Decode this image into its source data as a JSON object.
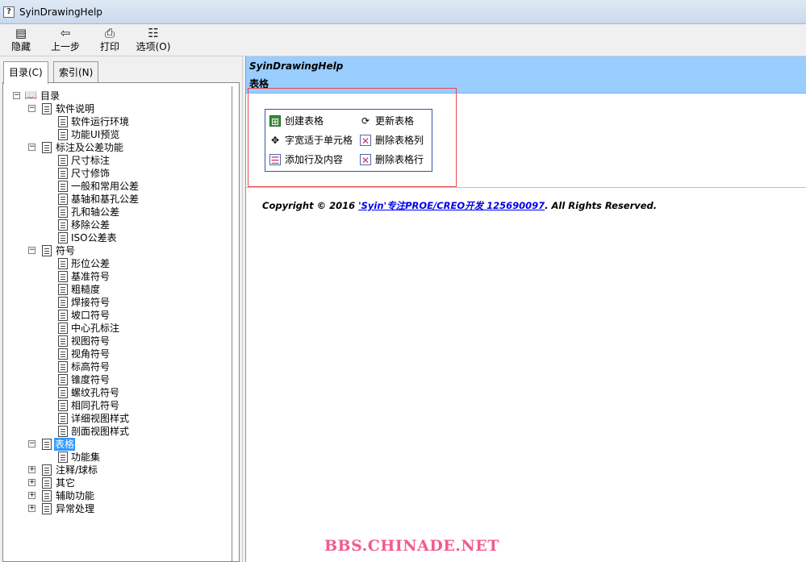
{
  "window": {
    "title": "SyinDrawingHelp",
    "icon": "help-question-icon"
  },
  "toolbar": {
    "buttons": [
      {
        "label": "隐藏",
        "icon": "hide-panel-icon"
      },
      {
        "label": "上一步",
        "icon": "back-arrow-icon"
      },
      {
        "label": "打印",
        "icon": "printer-icon"
      },
      {
        "label": "选项(O)",
        "icon": "options-icon"
      }
    ]
  },
  "nav_tabs": [
    {
      "label": "目录(C)",
      "active": true
    },
    {
      "label": "索引(N)",
      "active": false
    }
  ],
  "tree": {
    "root": "目录",
    "nodes": [
      "软件说明",
      "软件运行环境",
      "功能UI预览",
      "标注及公差功能",
      "尺寸标注",
      "尺寸修饰",
      "一般和常用公差",
      "基轴和基孔公差",
      "孔和轴公差",
      "移除公差",
      "ISO公差表",
      "符号",
      "形位公差",
      "基准符号",
      "粗糙度",
      "焊接符号",
      "坡口符号",
      "中心孔标注",
      "视图符号",
      "视角符号",
      "标高符号",
      "锥度符号",
      "螺纹孔符号",
      "相同孔符号",
      "详细视图样式",
      "剖面视图样式",
      "表格",
      "功能集",
      "注释/球标",
      "其它",
      "辅助功能",
      "异常处理"
    ],
    "toggles": {
      "minus": "−",
      "plus": "+"
    },
    "selected": "表格"
  },
  "content": {
    "header_app": "SyinDrawingHelp",
    "header_topic": "表格",
    "functions": [
      {
        "label": "创建表格",
        "icon": "create-table-icon"
      },
      {
        "label": "更新表格",
        "icon": "refresh-icon"
      },
      {
        "label": "字宽适于单元格",
        "icon": "fit-width-icon"
      },
      {
        "label": "删除表格列",
        "icon": "delete-column-icon"
      },
      {
        "label": "添加行及内容",
        "icon": "add-row-icon"
      },
      {
        "label": "删除表格行",
        "icon": "delete-row-icon"
      }
    ],
    "copyright_prefix": "Copyright © 2016 ",
    "copyright_link": "'Syin'专注PROE/CREO开发 125690097",
    "copyright_suffix": ". All Rights Reserved."
  },
  "watermark": "BBS.CHINADE.NET",
  "colors": {
    "header_bg": "#99ccff",
    "highlight_border": "#e8474a",
    "selection": "#3399ff",
    "watermark": "#f25c8c"
  }
}
